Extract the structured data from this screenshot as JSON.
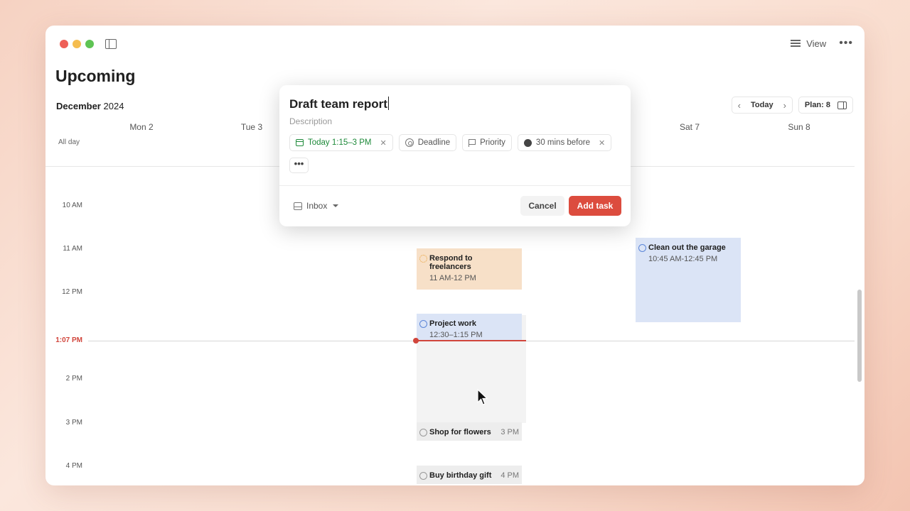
{
  "window": {
    "view_label": "View",
    "more_label": "•••"
  },
  "header": {
    "title": "Upcoming",
    "month": "December",
    "year": "2024",
    "today_label": "Today",
    "plan_label": "Plan: 8"
  },
  "days": [
    "Mon 2",
    "Tue 3",
    "Sat 7",
    "Sun 8"
  ],
  "allday_label": "All day",
  "times": [
    "10 AM",
    "11 AM",
    "12 PM",
    "1:07 PM",
    "2 PM",
    "3 PM",
    "4 PM"
  ],
  "events": [
    {
      "name": "Respond to freelancers",
      "time": "11 AM-12 PM",
      "color": "#f7e0c8"
    },
    {
      "name": "Project work",
      "time": "12:30–1:15 PM",
      "color": "#dbe4f6"
    },
    {
      "name": "Clean out the garage",
      "time": "10:45 AM-12:45 PM",
      "color": "#dbe4f6"
    },
    {
      "name": "Shop for flowers",
      "time": "3 PM",
      "color": "#ededed"
    },
    {
      "name": "Buy birthday gift",
      "time": "4 PM",
      "color": "#ededed"
    }
  ],
  "modal": {
    "title": "Draft team report",
    "description_placeholder": "Description",
    "chips": {
      "date": "Today 1:15–3 PM",
      "deadline": "Deadline",
      "priority": "Priority",
      "reminder": "30 mins before"
    },
    "more": "•••",
    "project": "Inbox",
    "cancel": "Cancel",
    "add": "Add task"
  },
  "colors": {
    "accent": "#dc4c3e",
    "now_line": "#d1453b",
    "date_green": "#1e8a3a"
  }
}
